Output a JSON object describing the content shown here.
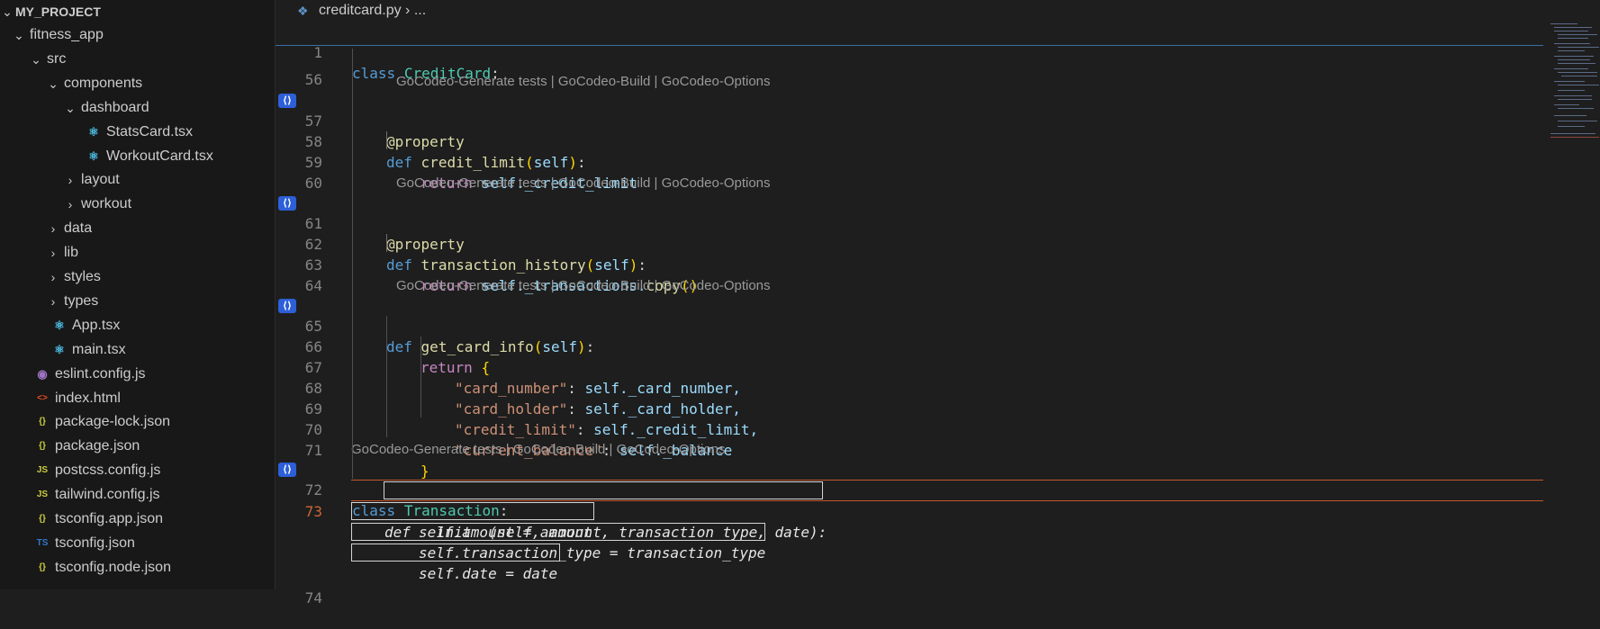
{
  "explorer": {
    "root": "MY_PROJECT",
    "items": [
      {
        "label": "fitness_app",
        "type": "folder",
        "open": true,
        "depth": 0
      },
      {
        "label": "src",
        "type": "folder",
        "open": true,
        "depth": 1
      },
      {
        "label": "components",
        "type": "folder",
        "open": true,
        "depth": 2
      },
      {
        "label": "dashboard",
        "type": "folder",
        "open": true,
        "depth": 3
      },
      {
        "label": "StatsCard.tsx",
        "type": "react",
        "depth": 4
      },
      {
        "label": "WorkoutCard.tsx",
        "type": "react",
        "depth": 4
      },
      {
        "label": "layout",
        "type": "folder",
        "open": false,
        "depth": 3
      },
      {
        "label": "workout",
        "type": "folder",
        "open": false,
        "depth": 3
      },
      {
        "label": "data",
        "type": "folder",
        "open": false,
        "depth": 2
      },
      {
        "label": "lib",
        "type": "folder",
        "open": false,
        "depth": 2
      },
      {
        "label": "styles",
        "type": "folder",
        "open": false,
        "depth": 2
      },
      {
        "label": "types",
        "type": "folder",
        "open": false,
        "depth": 2
      },
      {
        "label": "App.tsx",
        "type": "react",
        "depth": 2
      },
      {
        "label": "main.tsx",
        "type": "react",
        "depth": 2
      },
      {
        "label": "eslint.config.js",
        "type": "eslint",
        "depth": 1
      },
      {
        "label": "index.html",
        "type": "html",
        "depth": 1
      },
      {
        "label": "package-lock.json",
        "type": "json",
        "depth": 1
      },
      {
        "label": "package.json",
        "type": "json",
        "depth": 1
      },
      {
        "label": "postcss.config.js",
        "type": "js",
        "depth": 1
      },
      {
        "label": "tailwind.config.js",
        "type": "js",
        "depth": 1
      },
      {
        "label": "tsconfig.app.json",
        "type": "json",
        "depth": 1
      },
      {
        "label": "tsconfig.json",
        "type": "ts",
        "depth": 1
      },
      {
        "label": "tsconfig.node.json",
        "type": "json",
        "depth": 1
      }
    ]
  },
  "breadcrumb": {
    "file": "creditcard.py",
    "separator": "›",
    "more": "..."
  },
  "codelens": {
    "label": "GoCodeo-Generate tests | GoCodeo-Build | GoCodeo-Options"
  },
  "code_lines": {
    "l1": {
      "num": "1",
      "a": "class",
      "b": "CreditCard",
      ":": ":"
    },
    "l56": {
      "num": "56"
    },
    "l57": {
      "num": "57",
      "text": "@property"
    },
    "l58": {
      "num": "58",
      "kw": "def",
      "fn": "credit_limit",
      "args": "self"
    },
    "l59": {
      "num": "59",
      "kw": "return",
      "self": "self",
      "attr": "._credit_limit"
    },
    "l60": {
      "num": "60"
    },
    "l61": {
      "num": "61",
      "text": "@property"
    },
    "l62": {
      "num": "62",
      "kw": "def",
      "fn": "transaction_history",
      "args": "self"
    },
    "l63": {
      "num": "63",
      "kw": "return",
      "self": "self",
      "attr": "._transactions.",
      "call": "copy",
      "paren": "()"
    },
    "l64": {
      "num": "64"
    },
    "l65": {
      "num": "65",
      "kw": "def",
      "fn": "get_card_info",
      "args": "self"
    },
    "l66": {
      "num": "66",
      "kw": "return",
      "brace": "{"
    },
    "l67": {
      "num": "67",
      "key": "\"card_number\"",
      "self": "self",
      "attr": "._card_number,"
    },
    "l68": {
      "num": "68",
      "key": "\"card_holder\"",
      "self": "self",
      "attr": "._card_holder,"
    },
    "l69": {
      "num": "69",
      "key": "\"credit_limit\"",
      "self": "self",
      "attr": "._credit_limit,"
    },
    "l70": {
      "num": "70",
      "key": "\"current_balance\"",
      "self": "self",
      "attr": "._balance"
    },
    "l71": {
      "num": "71",
      "brace": "}"
    },
    "l72": {
      "num": "72",
      "kw": "class",
      "cls": "Transaction"
    },
    "l73": {
      "num": "73",
      "text": "def __init__(self, amount, transaction_type, date):"
    },
    "ghost1": "self.amount = amount",
    "ghost2": "self.transaction_type = transaction_type",
    "ghost3": "self.date = date",
    "l74": {
      "num": "74"
    }
  },
  "colors": {
    "keyword": "#569cd6",
    "control": "#c586c0",
    "class": "#4ec9b0",
    "function": "#dcdcaa",
    "variable": "#9cdcfe",
    "string": "#ce9178",
    "active_line_number": "#cc6633",
    "gocodeo_icon": "#2d5fd8"
  }
}
